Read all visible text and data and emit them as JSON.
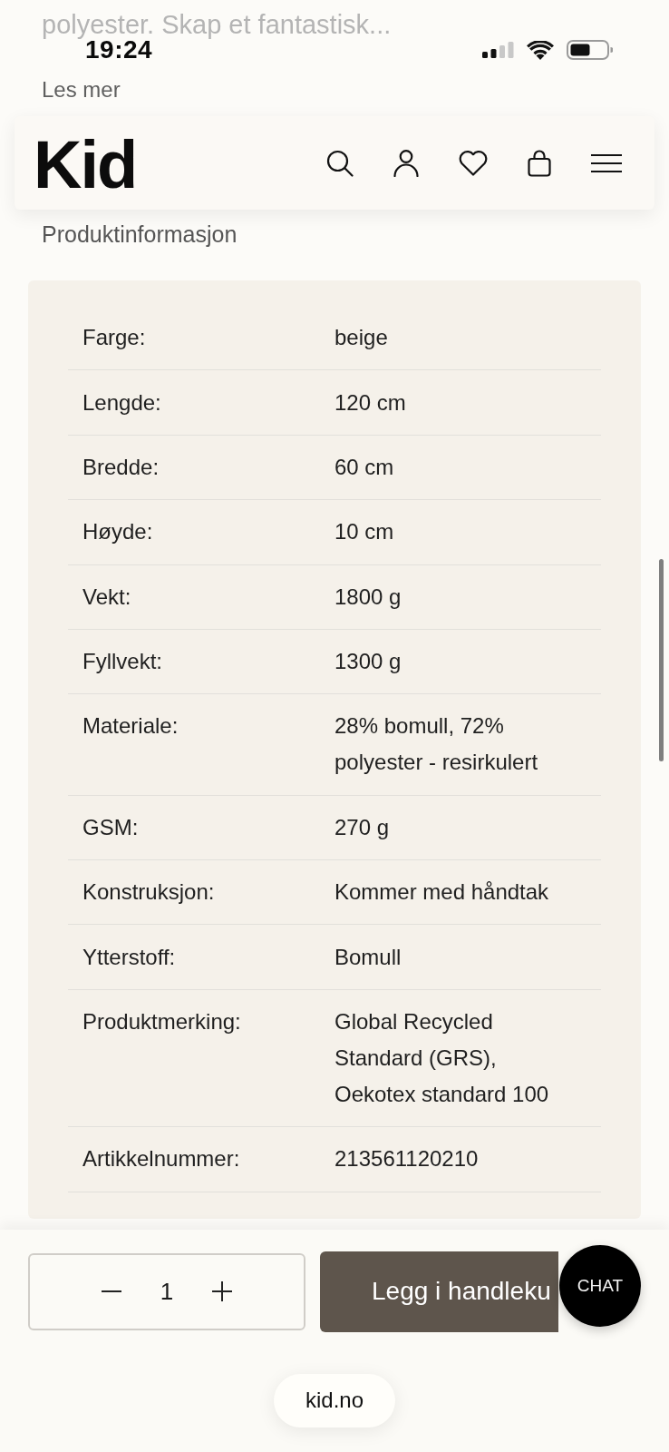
{
  "status_bar": {
    "time": "19:24"
  },
  "description": {
    "text": "polyester. Skap et fantastisk...",
    "link": "Les mer"
  },
  "header": {
    "logo": "Kid"
  },
  "product_info": {
    "title": "Produktinformasjon",
    "rows": [
      {
        "label": "Farge:",
        "value": "beige"
      },
      {
        "label": "Lengde:",
        "value": "120 cm"
      },
      {
        "label": "Bredde:",
        "value": "60 cm"
      },
      {
        "label": "Høyde:",
        "value": "10 cm"
      },
      {
        "label": "Vekt:",
        "value": "1800 g"
      },
      {
        "label": "Fyllvekt:",
        "value": "1300 g"
      },
      {
        "label": "Materiale:",
        "value": "28% bomull, 72% polyester - resirkulert"
      },
      {
        "label": "GSM:",
        "value": "270 g"
      },
      {
        "label": "Konstruksjon:",
        "value": "Kommer med håndtak"
      },
      {
        "label": "Ytterstoff:",
        "value": "Bomull"
      },
      {
        "label": "Produktmerking:",
        "value": "Global Recycled Standard (GRS), Oekotex standard 100"
      },
      {
        "label": "Artikkelnummer:",
        "value": "213561120210"
      }
    ]
  },
  "purchase_bar": {
    "quantity": "1",
    "add_to_cart": "Legg i handleku"
  },
  "chat_button": {
    "label": "CHAT"
  },
  "browser": {
    "address": "kid.no"
  }
}
